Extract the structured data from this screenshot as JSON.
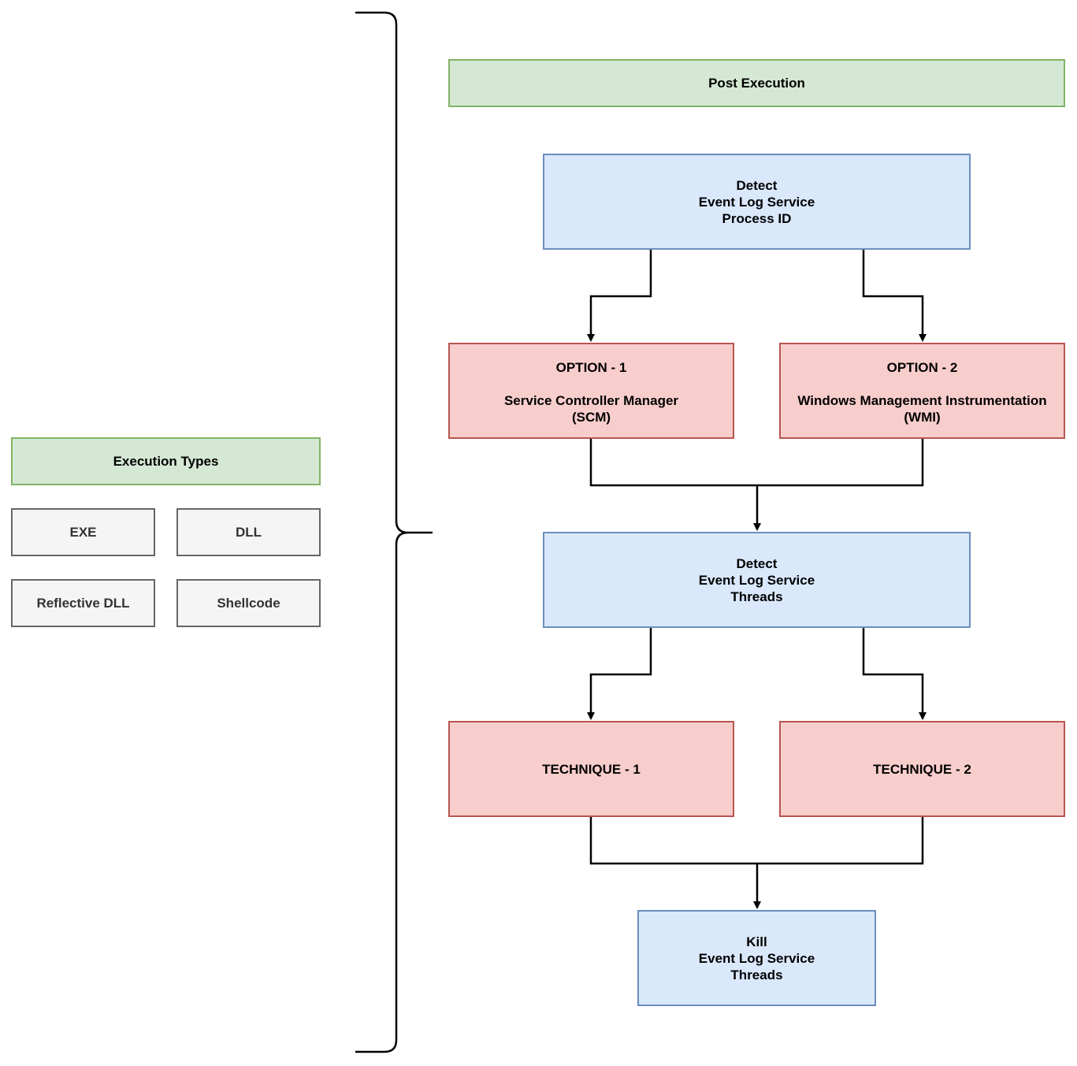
{
  "execution_types": {
    "title": "Execution Types",
    "items": [
      "EXE",
      "DLL",
      "Reflective DLL",
      "Shellcode"
    ]
  },
  "post_execution": {
    "title": "Post Execution",
    "detect_pid": "Detect\nEvent Log Service\nProcess ID",
    "option1": {
      "title": "OPTION - 1",
      "body": "Service Controller Manager\n(SCM)"
    },
    "option2": {
      "title": "OPTION - 2",
      "body": "Windows Management Instrumentation\n(WMI)"
    },
    "detect_threads": "Detect\nEvent Log Service\nThreads",
    "technique1": "TECHNIQUE - 1",
    "technique2": "TECHNIQUE - 2",
    "kill_threads": "Kill\nEvent Log Service\nThreads"
  },
  "colors": {
    "green_fill": "#d5e8d4",
    "green_stroke": "#82b366",
    "blue_fill": "#dae8fc",
    "blue_stroke": "#6c8ebf",
    "red_fill": "#f8cecc",
    "red_stroke": "#b85450",
    "gray_fill": "#f5f5f5",
    "gray_stroke": "#666666"
  }
}
